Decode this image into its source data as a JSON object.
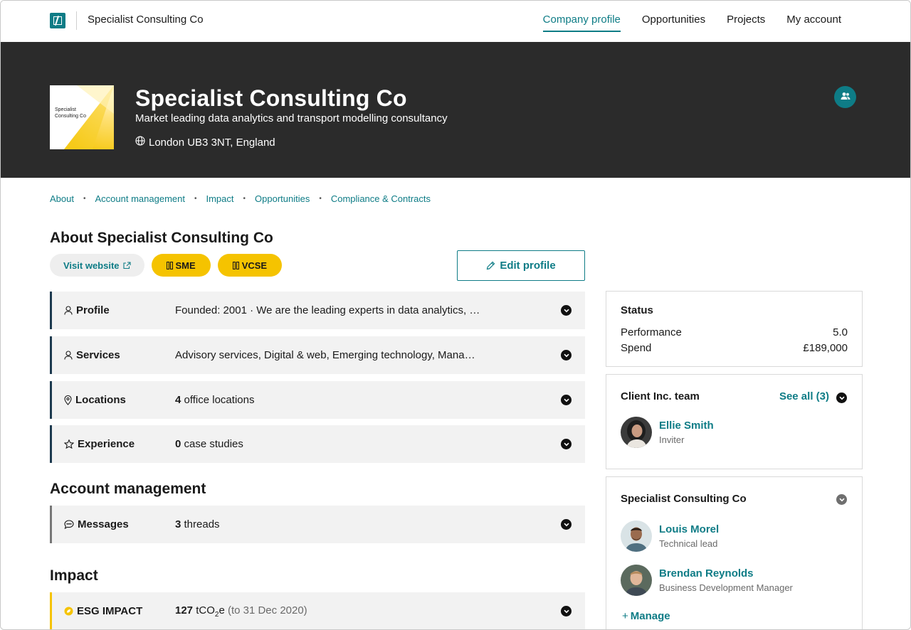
{
  "nav": {
    "brand": "Specialist Consulting Co",
    "links": [
      "Company profile",
      "Opportunities",
      "Projects",
      "My account"
    ]
  },
  "hero": {
    "logo_text": "Specialist\nConsulting Co",
    "title": "Specialist Consulting Co",
    "subtitle": "Market leading data analytics and transport modelling consultancy",
    "location": "London UB3 3NT, England"
  },
  "anchors": [
    "About",
    "Account management",
    "Impact",
    "Opportunities",
    "Compliance & Contracts"
  ],
  "about": {
    "heading": "About Specialist Consulting Co",
    "visit_website": "Visit website",
    "badges": [
      "SME",
      "VCSE"
    ],
    "edit_profile": "Edit profile",
    "rows": [
      {
        "label": "Profile",
        "value": "Founded: 2001 · We are the leading experts in data analytics, …"
      },
      {
        "label": "Services",
        "value": "Advisory services, Digital & web, Emerging technology, Mana…"
      },
      {
        "label": "Locations",
        "value_num": "4",
        "value_text": " office locations"
      },
      {
        "label": "Experience",
        "value_num": "0",
        "value_text": " case studies"
      }
    ]
  },
  "account": {
    "heading": "Account management",
    "label": "Messages",
    "value_num": "3",
    "value_text": " threads"
  },
  "impact": {
    "heading": "Impact",
    "label": "ESG IMPACT",
    "value_num": "127",
    "unit_pre": " tCO",
    "unit_sub": "2",
    "unit_post": "e",
    "note": " (to 31 Dec 2020)"
  },
  "status": {
    "title": "Status",
    "performance_label": "Performance",
    "performance_value": "5.0",
    "spend_label": "Spend",
    "spend_value": "£189,000"
  },
  "client_team": {
    "title": "Client Inc. team",
    "see_all": "See all (3)",
    "members": [
      {
        "name": "Ellie Smith",
        "role": "Inviter"
      }
    ]
  },
  "supplier_team": {
    "title": "Specialist Consulting Co",
    "members": [
      {
        "name": "Louis Morel",
        "role": "Technical lead"
      },
      {
        "name": "Brendan Reynolds",
        "role": "Business Development Manager"
      }
    ],
    "manage": "Manage"
  },
  "colors": {
    "teal": "#0e7c86",
    "yellow": "#f5c300",
    "hero_bg": "#2b2b2b"
  }
}
